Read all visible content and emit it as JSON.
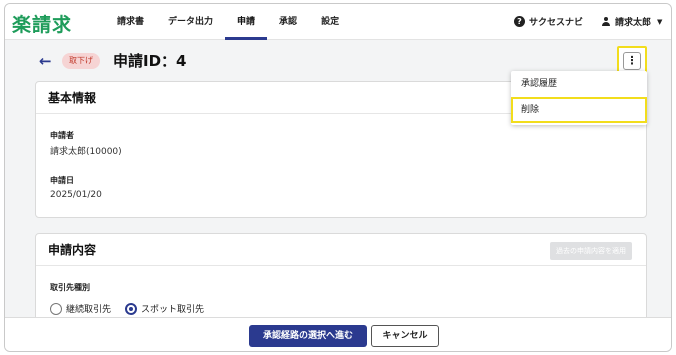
{
  "app": {
    "logo_mark": "楽",
    "logo_text": "楽請求"
  },
  "nav": {
    "items": [
      {
        "label": "請求書"
      },
      {
        "label": "データ出力"
      },
      {
        "label": "申請"
      },
      {
        "label": "承認"
      },
      {
        "label": "設定"
      }
    ],
    "active_index": 2
  },
  "header": {
    "help_label": "サクセスナビ",
    "user_name": "請求太郎"
  },
  "page": {
    "back_icon": "arrow-left-icon",
    "status_badge": "取下げ",
    "title": "申請ID：4",
    "more_icon": "more-vertical-icon"
  },
  "menu": {
    "items": [
      {
        "label": "承認履歴"
      },
      {
        "label": "削除"
      }
    ]
  },
  "basic_info": {
    "title": "基本情報",
    "applicant_label": "申請者",
    "applicant_value": "請求太郎(10000)",
    "date_label": "申請日",
    "date_value": "2025/01/20"
  },
  "content": {
    "title": "申請内容",
    "apply_past_label": "過去の申請内容を適用",
    "partner_type_label": "取引先種別",
    "options": [
      {
        "label": "継続取引先",
        "checked": false
      },
      {
        "label": "スポット取引先",
        "checked": true
      }
    ]
  },
  "footer": {
    "primary_label": "承認経路の選択へ進む",
    "cancel_label": "キャンセル"
  },
  "colors": {
    "brand": "#1e9c5a",
    "primary": "#2b3a8f",
    "highlight": "#f2dd1c",
    "badge_bg": "#f6d4d4",
    "badge_text": "#c0392b"
  }
}
